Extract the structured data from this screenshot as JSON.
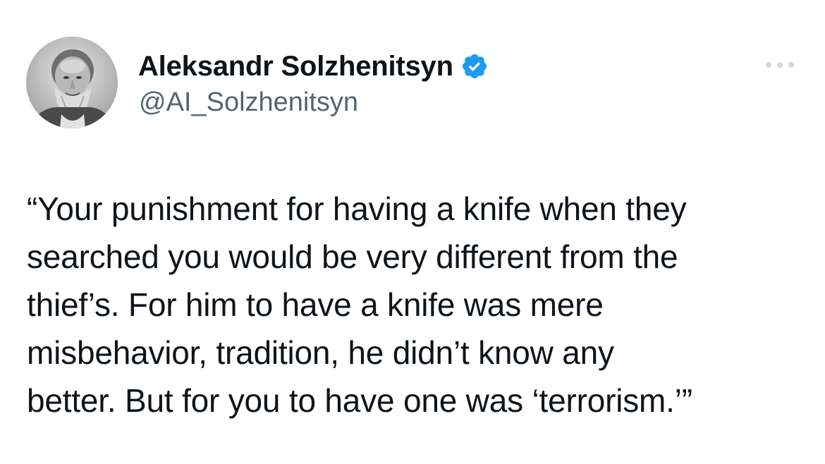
{
  "author": {
    "display_name": "Aleksandr Solzhenitsyn",
    "handle": "@AI_Solzhenitsyn",
    "verified": true,
    "avatar_icon": "portrait-avatar"
  },
  "header_actions": {
    "more_icon": "more-options-icon"
  },
  "tweet": {
    "lines": [
      "“Your punishment for having a knife when they",
      "searched you would be very different from the",
      "thief’s. For him to have a knife was mere",
      "misbehavior, tradition, he didn’t know any",
      "better. But for you to have one was ‘terrorism.’”"
    ]
  },
  "colors": {
    "text_primary": "#0f1419",
    "text_secondary": "#536471",
    "verified_blue": "#1d9bf0",
    "background": "#ffffff"
  }
}
